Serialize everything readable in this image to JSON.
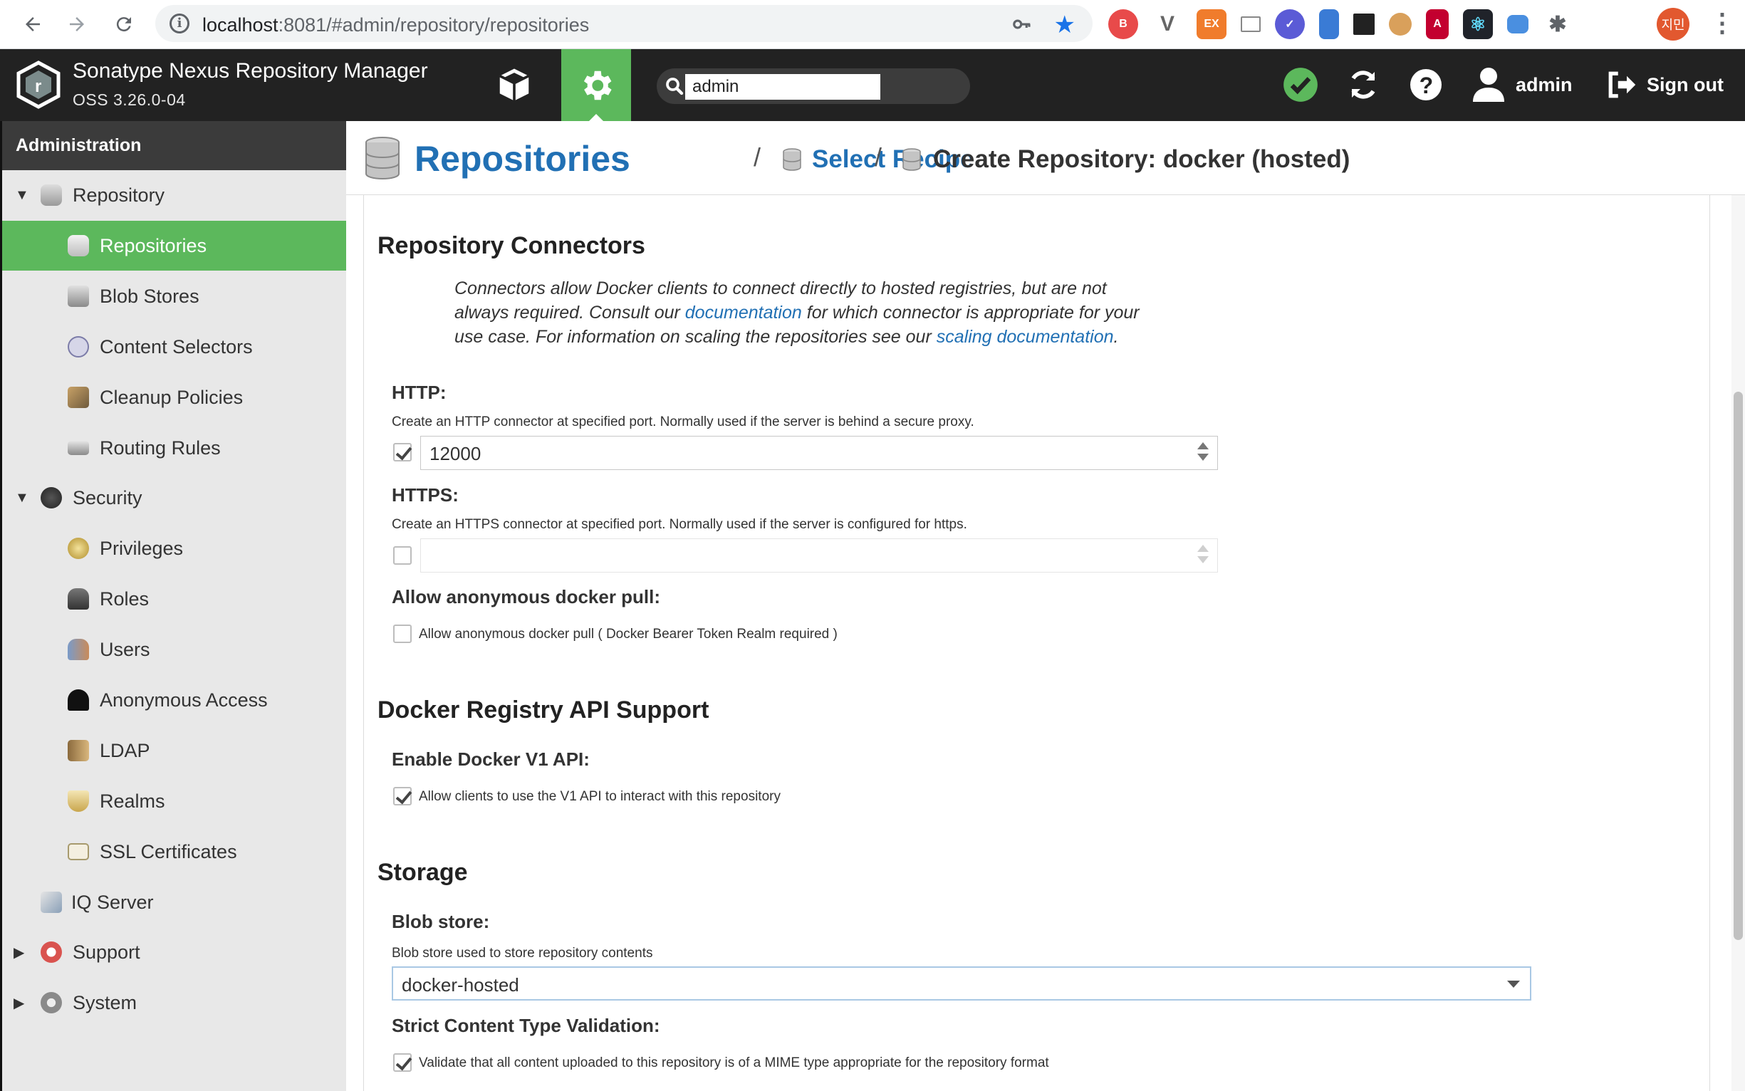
{
  "browser": {
    "url_host": "localhost",
    "url_rest": ":8081/#admin/repository/repositories",
    "profile_label": "지민"
  },
  "header": {
    "app_title": "Sonatype Nexus Repository Manager",
    "version": "OSS 3.26.0-04",
    "search_value": "admin",
    "user_label": "admin",
    "signout_label": "Sign out"
  },
  "sidebar": {
    "title": "Administration",
    "items": [
      {
        "label": "Repository"
      },
      {
        "label": "Repositories"
      },
      {
        "label": "Blob Stores"
      },
      {
        "label": "Content Selectors"
      },
      {
        "label": "Cleanup Policies"
      },
      {
        "label": "Routing Rules"
      },
      {
        "label": "Security"
      },
      {
        "label": "Privileges"
      },
      {
        "label": "Roles"
      },
      {
        "label": "Users"
      },
      {
        "label": "Anonymous Access"
      },
      {
        "label": "LDAP"
      },
      {
        "label": "Realms"
      },
      {
        "label": "SSL Certificates"
      },
      {
        "label": "IQ Server"
      },
      {
        "label": "Support"
      },
      {
        "label": "System"
      }
    ]
  },
  "breadcrumb": {
    "root": "Repositories",
    "sep": "/",
    "step": "Select Recipe",
    "current": "Create Repository: docker (hosted)"
  },
  "connectors": {
    "title": "Repository Connectors",
    "help_p1": "Connectors allow Docker clients to connect directly to hosted registries, but are not always required. Consult our ",
    "help_link1": "documentation",
    "help_p2": " for which connector is appropriate for your use case. For information on scaling the repositories see our ",
    "help_link2": "scaling documentation",
    "help_p3": ".",
    "http_label": "HTTP:",
    "http_desc": "Create an HTTP connector at specified port. Normally used if the server is behind a secure proxy.",
    "http_value": "12000",
    "https_label": "HTTPS:",
    "https_desc": "Create an HTTPS connector at specified port. Normally used if the server is configured for https.",
    "https_value": "",
    "anon_label": "Allow anonymous docker pull:",
    "anon_checkbox": "Allow anonymous docker pull ( Docker Bearer Token Realm required )"
  },
  "api": {
    "title": "Docker Registry API Support",
    "v1_label": "Enable Docker V1 API:",
    "v1_checkbox": "Allow clients to use the V1 API to interact with this repository"
  },
  "storage": {
    "title": "Storage",
    "blob_label": "Blob store:",
    "blob_desc": "Blob store used to store repository contents",
    "blob_value": "docker-hosted",
    "strict_label": "Strict Content Type Validation:",
    "strict_checkbox": "Validate that all content uploaded to this repository is of a MIME type appropriate for the repository format"
  },
  "colors": {
    "accent_green": "#5cb85c",
    "link_blue": "#2170b4",
    "header_dark": "#222222"
  }
}
